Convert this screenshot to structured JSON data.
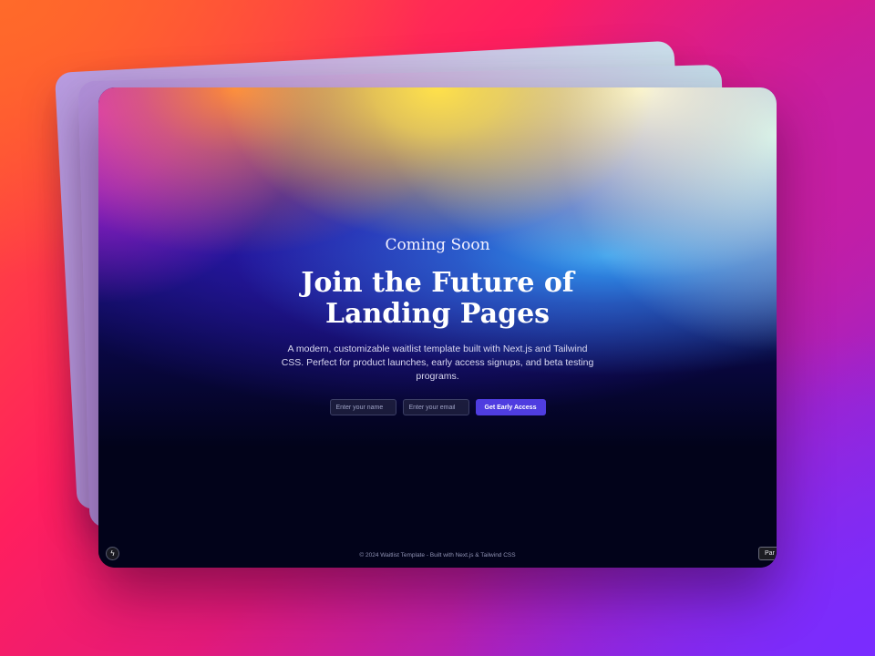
{
  "hero": {
    "eyebrow": "Coming Soon",
    "headline": "Join the Future of Landing Pages",
    "description": "A modern, customizable waitlist template built with Next.js and Tailwind CSS. Perfect for product launches, early access signups, and beta testing programs."
  },
  "form": {
    "name_placeholder": "Enter your name",
    "email_placeholder": "Enter your email",
    "submit_label": "Get Early Access"
  },
  "footer": {
    "text": "© 2024 Waitlist Template - Built with Next.js & Tailwind CSS"
  },
  "overlay": {
    "badge_icon": "lightning-icon",
    "badge_glyph": "ϟ",
    "side_tab_label": "Par"
  },
  "colors": {
    "accent": "#4f3de0",
    "page_background": "#02031a"
  }
}
